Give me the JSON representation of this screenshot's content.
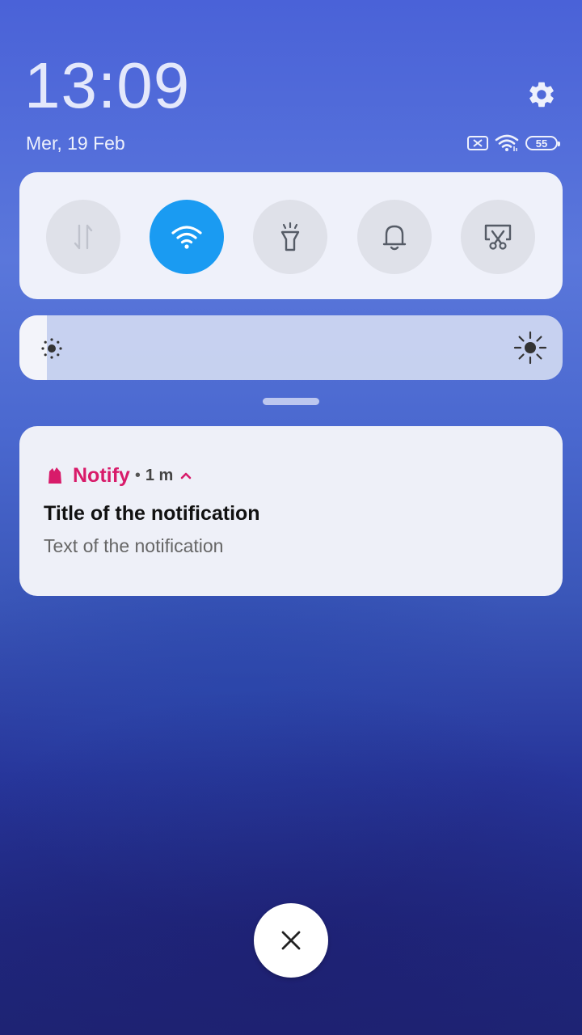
{
  "header": {
    "time": "13:09",
    "date": "Mer, 19 Feb",
    "battery_level": "55"
  },
  "quick_settings": {
    "tiles": [
      {
        "name": "mobile-data",
        "icon": "data-transfer-icon",
        "active": false
      },
      {
        "name": "wifi",
        "icon": "wifi-icon",
        "active": true
      },
      {
        "name": "flashlight",
        "icon": "flashlight-icon",
        "active": false
      },
      {
        "name": "sound",
        "icon": "bell-icon",
        "active": false
      },
      {
        "name": "screenshot",
        "icon": "screenshot-scissors-icon",
        "active": false
      }
    ],
    "active_color": "#1a9bf2"
  },
  "brightness": {
    "level": 0.05
  },
  "notification": {
    "app_name": "Notify",
    "time": "1 m",
    "title": "Title of the notification",
    "text": "Text of the notification",
    "accent_color": "#d81b6a"
  }
}
